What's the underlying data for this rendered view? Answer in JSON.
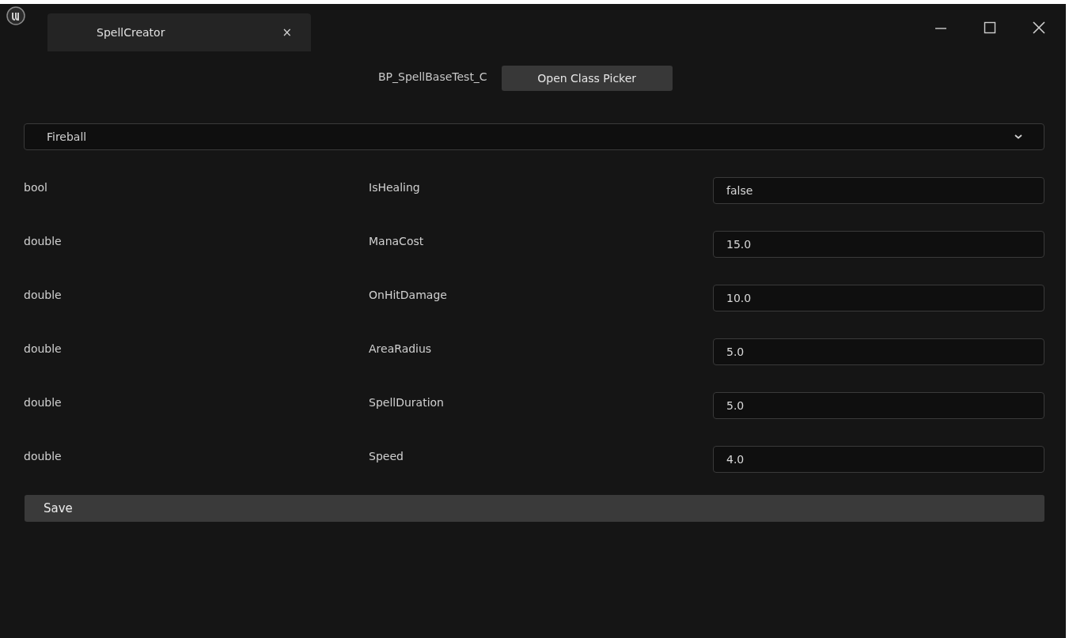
{
  "window": {
    "tab_title": "SpellCreator",
    "tab_close": "×"
  },
  "class_picker": {
    "class_name": "BP_SpellBaseTest_C",
    "button": "Open Class Picker"
  },
  "spell_dropdown": {
    "value": "Fireball"
  },
  "properties": [
    {
      "type": "bool",
      "name": "IsHealing",
      "value": "false"
    },
    {
      "type": "double",
      "name": "ManaCost",
      "value": "15.0"
    },
    {
      "type": "double",
      "name": "OnHitDamage",
      "value": "10.0"
    },
    {
      "type": "double",
      "name": "AreaRadius",
      "value": "5.0"
    },
    {
      "type": "double",
      "name": "SpellDuration",
      "value": "5.0"
    },
    {
      "type": "double",
      "name": "Speed",
      "value": "4.0"
    }
  ],
  "save_button": "Save"
}
